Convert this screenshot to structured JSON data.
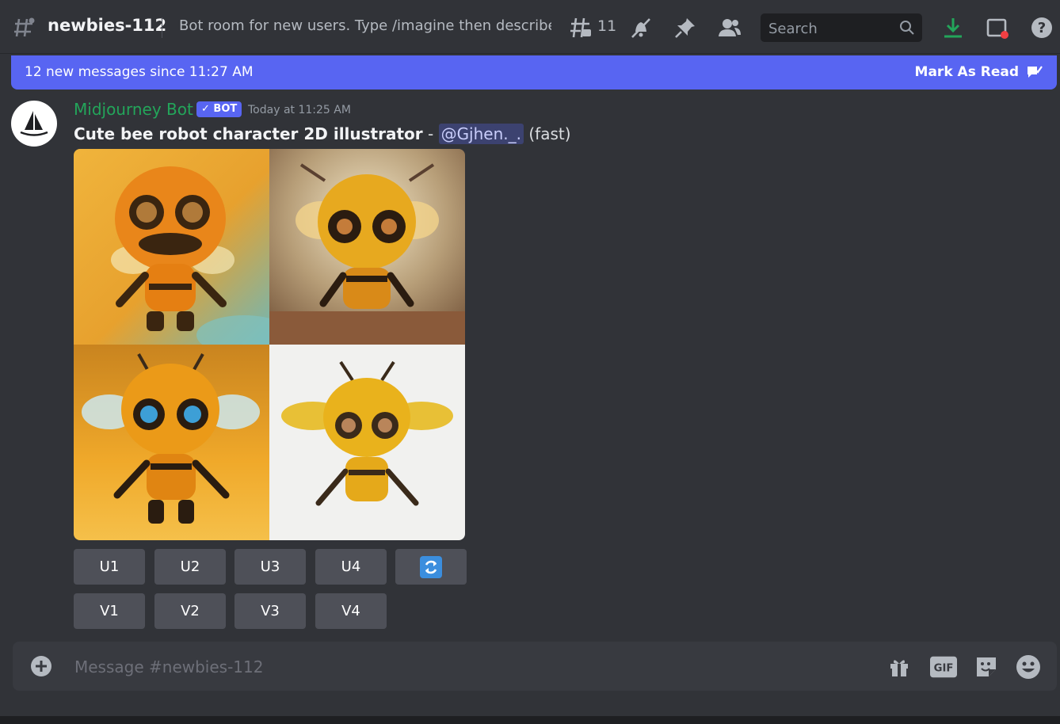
{
  "header": {
    "channel_name": "newbies-112",
    "topic": "Bot room for new users. Type /imagine then describe ...",
    "threads_count": "11",
    "search_placeholder": "Search"
  },
  "new_messages_bar": {
    "text": "12 new messages since 11:27 AM",
    "mark_read_label": "Mark As Read"
  },
  "message": {
    "author": "Midjourney Bot",
    "bot_tag": "✓ BOT",
    "timestamp": "Today at 11:25 AM",
    "prompt": "Cute bee robot character 2D illustrator",
    "separator": " - ",
    "mention": "@Gjhen._.",
    "mode": " (fast)"
  },
  "buttons": {
    "upscale": [
      "U1",
      "U2",
      "U3",
      "U4"
    ],
    "variation": [
      "V1",
      "V2",
      "V3",
      "V4"
    ]
  },
  "composer": {
    "placeholder": "Message #newbies-112",
    "gif_label": "GIF"
  },
  "colors": {
    "accent": "#5865f2",
    "bot_name": "#23a55a",
    "download": "#23a55a"
  }
}
